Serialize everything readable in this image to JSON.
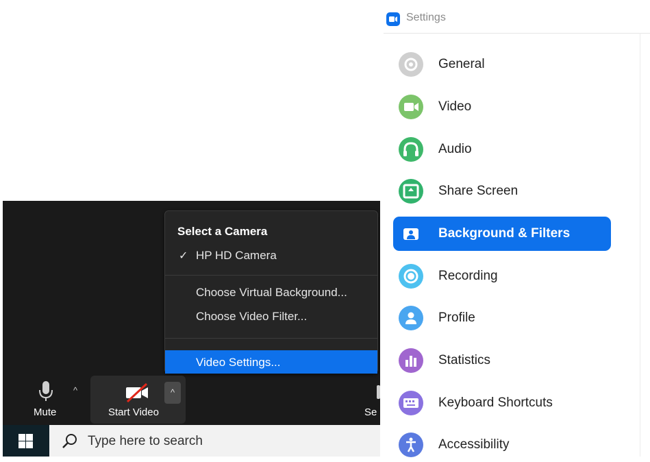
{
  "meeting": {
    "camera_menu": {
      "header": "Select a Camera",
      "selected_camera": "HP HD Camera",
      "items": [
        "Choose Virtual Background...",
        "Choose Video Filter...",
        "Video Settings..."
      ],
      "highlighted_item": "Video Settings..."
    },
    "toolbar": {
      "mute_label": "Mute",
      "start_video_label": "Start Video",
      "truncated_label": "Se"
    },
    "taskbar": {
      "search_placeholder": "Type here to search"
    }
  },
  "settings": {
    "title": "Settings",
    "nav": [
      {
        "label": "General",
        "icon": "gear-icon",
        "color": "#cfcfcf"
      },
      {
        "label": "Video",
        "icon": "video-camera-icon",
        "color": "#7cc46a"
      },
      {
        "label": "Audio",
        "icon": "headphones-icon",
        "color": "#3eb86a"
      },
      {
        "label": "Share Screen",
        "icon": "share-screen-icon",
        "color": "#32b36d"
      },
      {
        "label": "Background & Filters",
        "icon": "portrait-icon",
        "color": "#ffffff",
        "active": true
      },
      {
        "label": "Recording",
        "icon": "record-icon",
        "color": "#4dc1f0"
      },
      {
        "label": "Profile",
        "icon": "user-icon",
        "color": "#4aa6f0"
      },
      {
        "label": "Statistics",
        "icon": "bar-chart-icon",
        "color": "#a066cf"
      },
      {
        "label": "Keyboard Shortcuts",
        "icon": "keyboard-icon",
        "color": "#8a72e0"
      },
      {
        "label": "Accessibility",
        "icon": "accessibility-icon",
        "color": "#5a7ae0"
      }
    ],
    "accent_color": "#0e71eb"
  }
}
